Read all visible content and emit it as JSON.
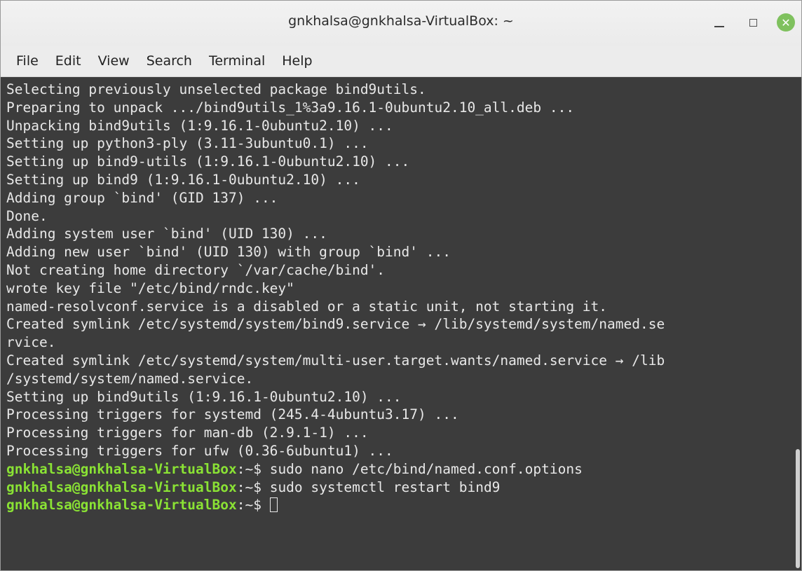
{
  "window": {
    "title": "gnkhalsa@gnkhalsa-VirtualBox: ~",
    "minimize_icon": "minimize-icon",
    "maximize_icon": "maximize-icon",
    "close_icon": "close-icon",
    "close_glyph": "✕",
    "close_color": "#7fc15e"
  },
  "menu": {
    "file": "File",
    "edit": "Edit",
    "view": "View",
    "search": "Search",
    "terminal": "Terminal",
    "help": "Help"
  },
  "terminal": {
    "output": [
      "Selecting previously unselected package bind9utils.",
      "Preparing to unpack .../bind9utils_1%3a9.16.1-0ubuntu2.10_all.deb ...",
      "Unpacking bind9utils (1:9.16.1-0ubuntu2.10) ...",
      "Setting up python3-ply (3.11-3ubuntu0.1) ...",
      "Setting up bind9-utils (1:9.16.1-0ubuntu2.10) ...",
      "Setting up bind9 (1:9.16.1-0ubuntu2.10) ...",
      "Adding group `bind' (GID 137) ...",
      "Done.",
      "Adding system user `bind' (UID 130) ...",
      "Adding new user `bind' (UID 130) with group `bind' ...",
      "Not creating home directory `/var/cache/bind'.",
      "wrote key file \"/etc/bind/rndc.key\"",
      "named-resolvconf.service is a disabled or a static unit, not starting it.",
      "Created symlink /etc/systemd/system/bind9.service → /lib/systemd/system/named.se",
      "rvice.",
      "Created symlink /etc/systemd/system/multi-user.target.wants/named.service → /lib",
      "/systemd/system/named.service.",
      "Setting up bind9utils (1:9.16.1-0ubuntu2.10) ...",
      "Processing triggers for systemd (245.4-4ubuntu3.17) ...",
      "Processing triggers for man-db (2.9.1-1) ...",
      "Processing triggers for ufw (0.36-6ubuntu1) ..."
    ],
    "prompt_user": "gnkhalsa@gnkhalsa-VirtualBox",
    "prompt_path": ":~$ ",
    "commands": [
      "sudo nano /etc/bind/named.conf.options",
      "sudo systemctl restart bind9",
      ""
    ],
    "prompt_color": "#8ae234",
    "text_color": "#e8e8e8",
    "background_color": "#3c3c3c"
  }
}
